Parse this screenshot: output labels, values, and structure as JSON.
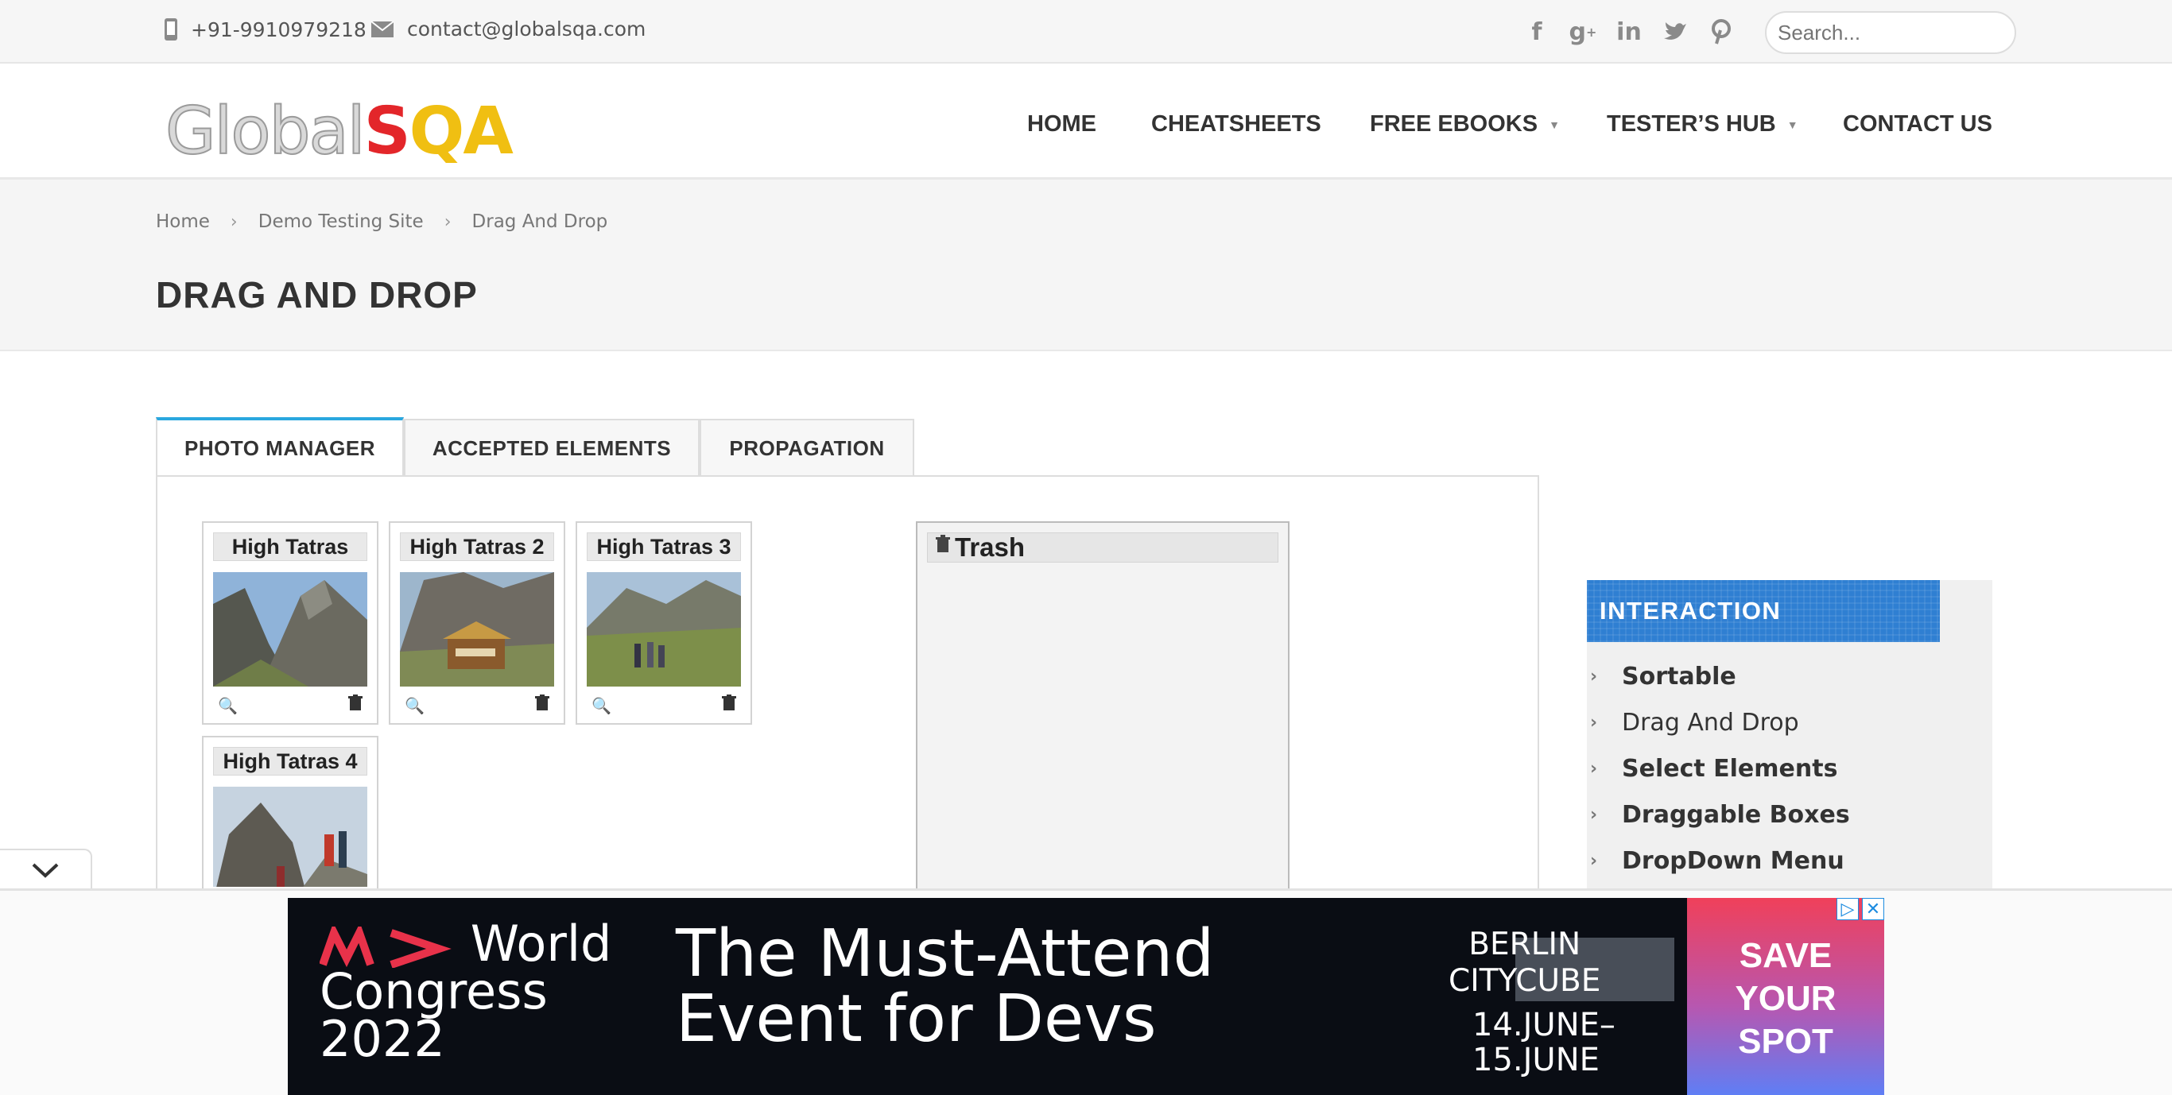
{
  "topbar": {
    "phone": "+91-9910979218",
    "email": "contact@globalsqa.com",
    "social": [
      "facebook-icon",
      "google-plus-icon",
      "linkedin-icon",
      "twitter-icon",
      "pinterest-icon"
    ],
    "search_placeholder": "Search..."
  },
  "logo": {
    "part1": "Global",
    "part2": "S",
    "part3": "QA"
  },
  "nav": {
    "home": "HOME",
    "cheatsheets": "CHEATSHEETS",
    "free_ebooks": "FREE EBOOKS",
    "testers_hub": "TESTER’S HUB",
    "contact": "CONTACT US"
  },
  "breadcrumb": [
    "Home",
    "Demo Testing Site",
    "Drag And Drop"
  ],
  "page_title": "DRAG AND DROP",
  "tabs": [
    "PHOTO MANAGER",
    "ACCEPTED ELEMENTS",
    "PROPAGATION"
  ],
  "photos": [
    "High Tatras",
    "High Tatras 2",
    "High Tatras 3",
    "High Tatras 4"
  ],
  "trash_label": "Trash",
  "sidebar": {
    "heading": "INTERACTION",
    "items": [
      "Sortable",
      "Drag And Drop",
      "Select Elements",
      "Draggable Boxes",
      "DropDown Menu"
    ]
  },
  "ad": {
    "brand_line1": "World",
    "brand_line2": "Congress",
    "brand_line3": "2022",
    "headline1": "The Must-Attend",
    "headline2": "Event for Devs",
    "city1": "BERLIN",
    "city2": "CITYCUBE",
    "date1": "14.JUNE–",
    "date2": "15.JUNE",
    "cta1": "SAVE",
    "cta2": "YOUR",
    "cta3": "SPOT"
  },
  "colors": {
    "accent": "#2aa7df",
    "sidebar_head": "#2f7fd2",
    "logo_red": "#e3262a",
    "logo_yellow": "#f0bf12"
  }
}
